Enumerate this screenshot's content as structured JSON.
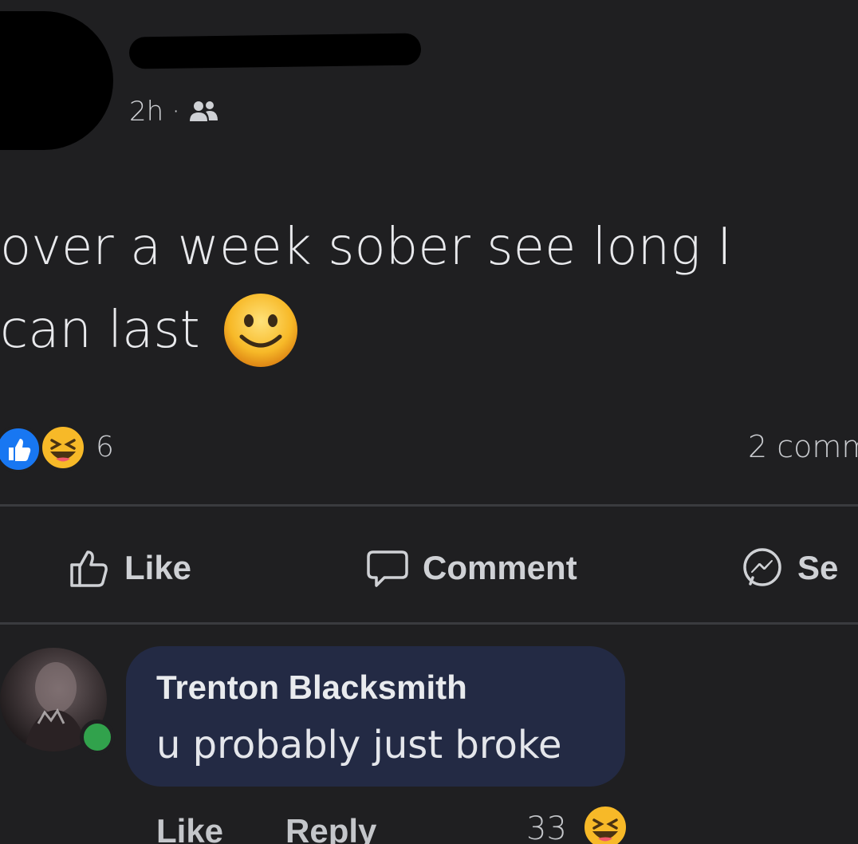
{
  "post": {
    "time": "2h",
    "separator": "·",
    "audience_icon": "friends-icon",
    "text_line1": "over a week sober see long I",
    "text_line2": "can last",
    "emoji": "slightly-smiling-face-icon"
  },
  "reactions": {
    "icons": [
      "like-reaction-icon",
      "haha-reaction-icon"
    ],
    "count": "6",
    "comments_label": "2 comm"
  },
  "actions": {
    "like_label": "Like",
    "comment_label": "Comment",
    "send_label": "Se"
  },
  "comment": {
    "author": "Trenton Blacksmith",
    "text": "u probably just broke",
    "like_label": "Like",
    "reply_label": "Reply",
    "reaction_count": "33",
    "reaction_icon": "haha-reaction-icon"
  },
  "colors": {
    "background": "#1f1f21",
    "comment_bubble": "#232a44",
    "like_blue": "#1877f2",
    "haha_yellow": "#f7b928",
    "online_green": "#31a24c"
  }
}
